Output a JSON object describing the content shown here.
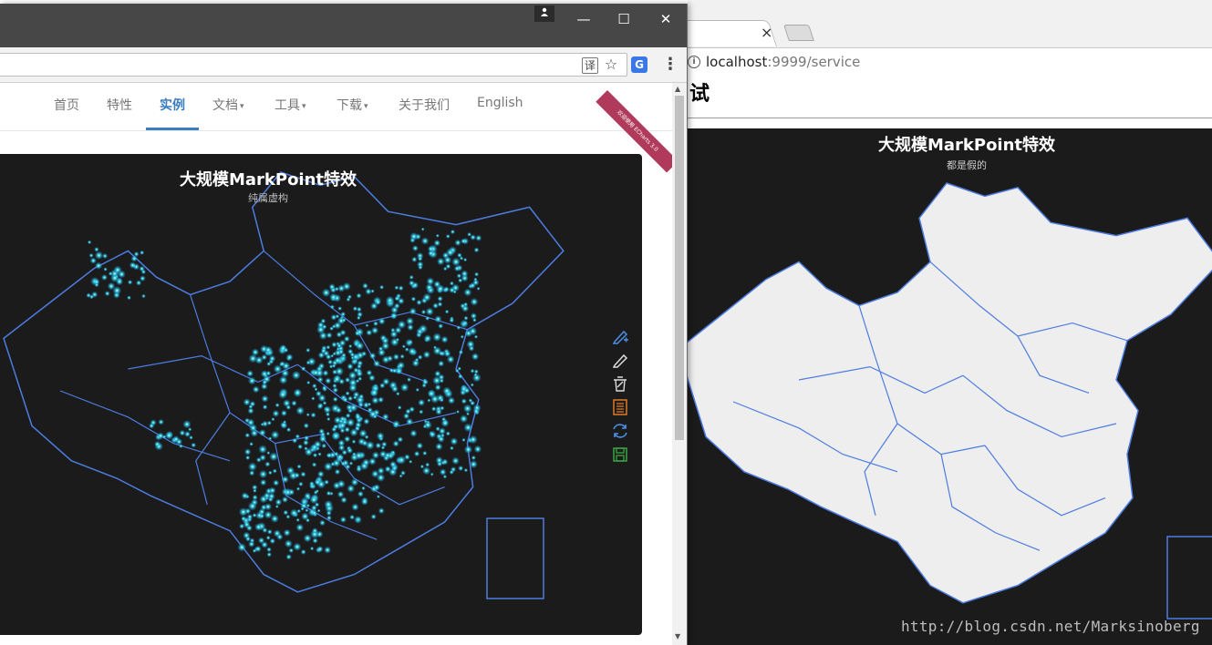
{
  "right_window": {
    "tab_close": "×",
    "url_host": "localhost",
    "url_rest": ":9999/service",
    "page_heading": "试",
    "chart": {
      "title": "大规模MarkPoint特效",
      "subtitle": "都是假的"
    }
  },
  "left_window": {
    "user_icon": "person-icon",
    "window_controls": {
      "minimize": "—",
      "maximize": "☐",
      "close": "✕"
    },
    "toolbar": {
      "translate": "译",
      "star": "☆",
      "extension": "G",
      "menu": "⋮"
    },
    "nav": {
      "items": [
        {
          "label": "首页",
          "dropdown": false
        },
        {
          "label": "特性",
          "dropdown": false
        },
        {
          "label": "实例",
          "dropdown": false,
          "active": true
        },
        {
          "label": "文档",
          "dropdown": true
        },
        {
          "label": "工具",
          "dropdown": true
        },
        {
          "label": "下载",
          "dropdown": true
        },
        {
          "label": "关于我们",
          "dropdown": false
        },
        {
          "label": "English",
          "dropdown": false
        }
      ],
      "caret": "▾",
      "ribbon": "欢迎使用 ECharts 3.0"
    },
    "chart": {
      "title": "大规模MarkPoint特效",
      "subtitle": "纯属虚构",
      "tools": [
        "mark-icon",
        "mark-undo-icon",
        "mark-clear-icon",
        "data-view-icon",
        "restore-icon",
        "save-as-image-icon"
      ]
    }
  },
  "watermark": "http://blog.csdn.net/Marksinoberg",
  "colors": {
    "chart_bg": "#1b1b1b",
    "border_line": "#4d7ce0",
    "point_cyan": "#22d3d6",
    "point_blue": "#2f7fe8",
    "land_fill": "#eeeeee",
    "nav_active": "#3a7ebf"
  }
}
